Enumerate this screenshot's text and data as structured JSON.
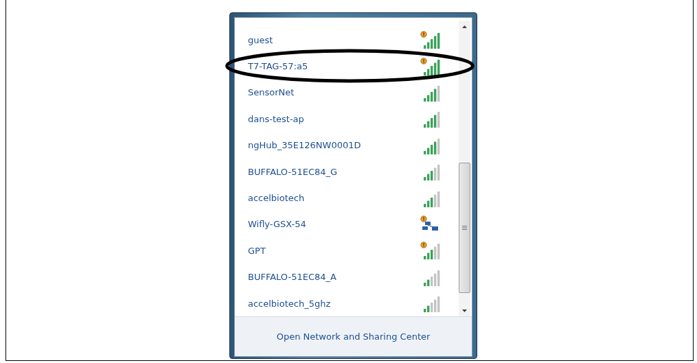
{
  "networks": [
    {
      "name": "guest",
      "kind": "full-signal",
      "warning": true,
      "circled": false
    },
    {
      "name": "T7-TAG-57:a5",
      "kind": "full-signal",
      "warning": true,
      "circled": true
    },
    {
      "name": "SensorNet",
      "kind": "high-signal",
      "warning": false,
      "circled": false
    },
    {
      "name": "dans-test-ap",
      "kind": "high-signal",
      "warning": false,
      "circled": false
    },
    {
      "name": "ngHub_35E126NW0001D",
      "kind": "high-signal",
      "warning": false,
      "circled": false
    },
    {
      "name": "BUFFALO-51EC84_G",
      "kind": "medium-signal",
      "warning": false,
      "circled": false
    },
    {
      "name": "accelbiotech",
      "kind": "medium-signal",
      "warning": false,
      "circled": false
    },
    {
      "name": "Wifly-GSX-54",
      "kind": "adhoc",
      "warning": true,
      "circled": false
    },
    {
      "name": "GPT",
      "kind": "medium-signal",
      "warning": true,
      "circled": false
    },
    {
      "name": "BUFFALO-51EC84_A",
      "kind": "low-signal",
      "warning": false,
      "circled": false
    },
    {
      "name": "accelbiotech_5ghz",
      "kind": "low-signal",
      "warning": false,
      "circled": false
    }
  ],
  "footer_link": "Open Network and Sharing Center"
}
